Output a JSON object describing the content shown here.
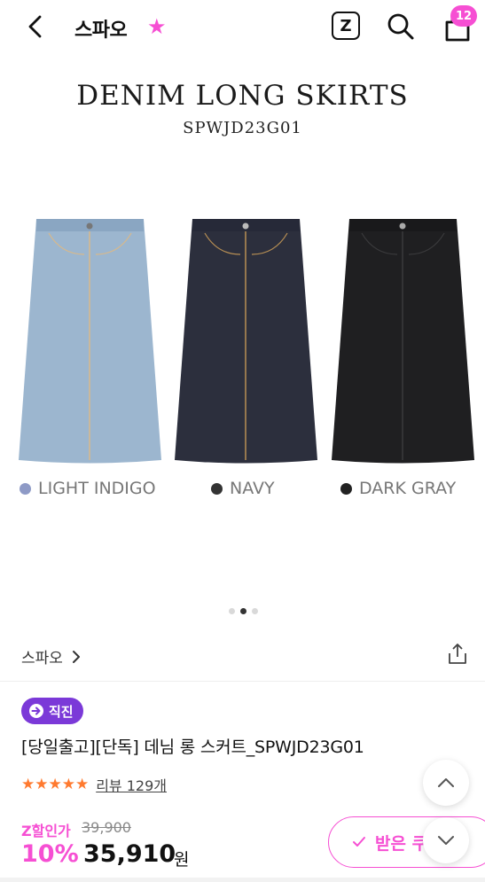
{
  "header": {
    "brand_title": "스파오",
    "z_label": "Z",
    "cart_count": "12"
  },
  "hero": {
    "title": "DENIM LONG SKIRTS",
    "code": "SPWJD23G01",
    "colors": [
      {
        "name": "LIGHT INDIGO",
        "dot": "#8e9ac6",
        "fabric": "#9cb6cf"
      },
      {
        "name": "NAVY",
        "dot": "#333333",
        "fabric": "#2c2f3d"
      },
      {
        "name": "DARK GRAY",
        "dot": "#222222",
        "fabric": "#1f1f21"
      }
    ],
    "pager_active": 2,
    "pager_total": 3
  },
  "brand_row": {
    "label": "스파오"
  },
  "product": {
    "tag": "직진",
    "name": "[당일출고][단독] 데님 롱 스커트_SPWJD23G01",
    "stars": "★★★★★",
    "review_label": "리뷰 129개",
    "zprice_label": "Z할인가",
    "original_price": "39,900",
    "discount": "10%",
    "price": "35,910",
    "currency": "원"
  },
  "coupon": {
    "label": "받은 쿠"
  },
  "accent_color": "#f64fd3",
  "tag_color": "#7b39d8"
}
